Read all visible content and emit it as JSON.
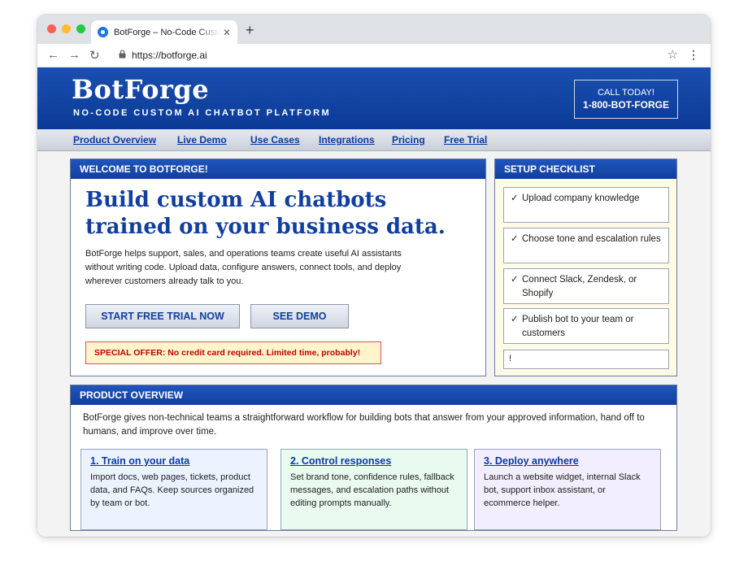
{
  "browser": {
    "tab_title": "BotForge – No-Code Custom AI Chatbot Platform",
    "url": "https://botforge.ai",
    "new_tab": "+",
    "tab_close": "✕"
  },
  "header": {
    "brand": "BotForge",
    "tagline": "NO-CODE CUSTOM AI CHATBOT PLATFORM",
    "call_label": "CALL TODAY!",
    "call_number": "1-800-BOT-FORGE"
  },
  "nav": {
    "items": [
      "Product Overview",
      "Live Demo",
      "Use Cases",
      "Integrations",
      "Pricing",
      "Free Trial"
    ]
  },
  "welcome": {
    "heading": "WELCOME TO BOTFORGE!",
    "headline_1": "Build custom AI chatbots",
    "headline_2": "trained on your business data.",
    "lead": "BotForge helps support, sales, and operations teams create useful AI assistants without writing code. Upload data, configure answers, connect tools, and deploy wherever customers already talk to you.",
    "cta_trial": "START FREE TRIAL NOW",
    "cta_demo": "SEE DEMO",
    "offer": "SPECIAL OFFER: No credit card required. Limited time, probably!"
  },
  "checklist": {
    "heading": "SETUP CHECKLIST",
    "check_mark": "✓",
    "items": [
      "Upload company knowledge",
      "Choose tone and escalation rules",
      "Connect Slack, Zendesk, or Shopify",
      "Publish bot to your team or customers"
    ],
    "last_item": "!"
  },
  "overview": {
    "heading": "PRODUCT OVERVIEW",
    "text": "BotForge gives non-technical teams a straightforward workflow for building bots that answer from your approved information, hand off to humans, and improve over time.",
    "cards": [
      {
        "title": "1. Train on your data",
        "body": "Import docs, web pages, tickets, product data, and FAQs. Keep sources organized by team or bot."
      },
      {
        "title": "2. Control responses",
        "body": "Set brand tone, confidence rules, fallback messages, and escalation paths without editing prompts manually."
      },
      {
        "title": "3. Deploy anywhere",
        "body": "Launch a website widget, internal Slack bot, support inbox assistant, or ecommerce helper."
      }
    ]
  }
}
